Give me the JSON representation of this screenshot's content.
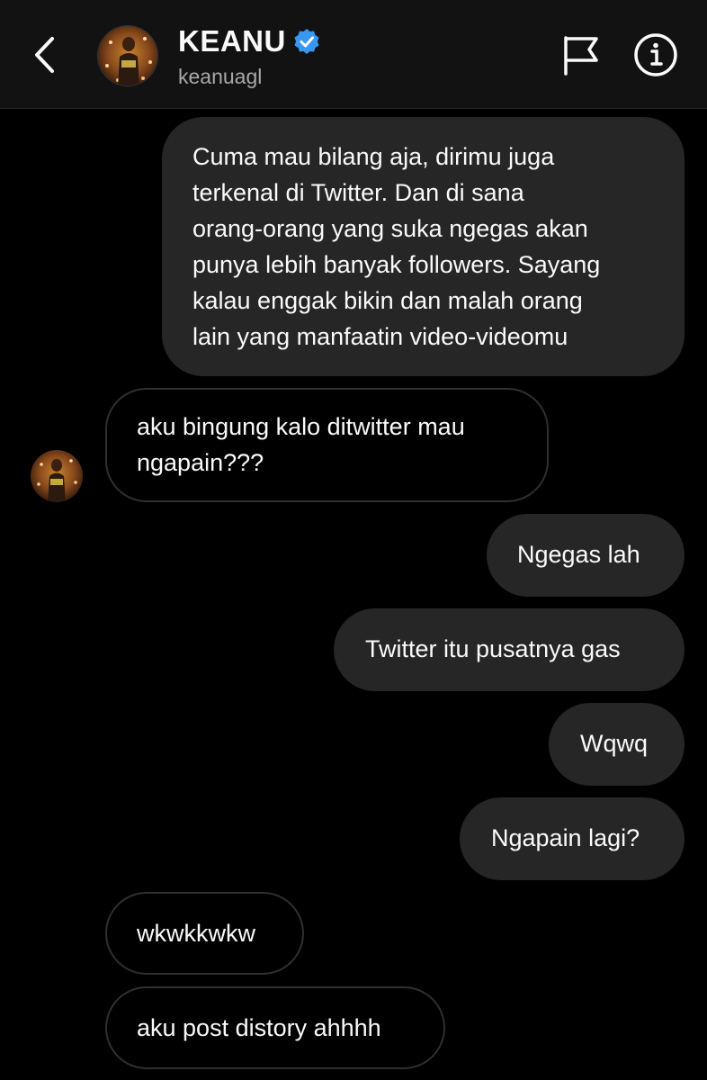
{
  "header": {
    "name": "KEANU",
    "username": "keanuagl",
    "verified": true,
    "icons": {
      "back": "chevron-left-icon",
      "report": "flag-icon",
      "info": "info-circle-icon"
    },
    "accent_color": "#3897f0"
  },
  "messages": [
    {
      "from": "me",
      "text": "Cuma mau bilang aja, dirimu juga\nterkenal di Twitter. Dan di sana\norang-orang yang suka ngegas akan\npunya lebih banyak followers. Sayang\nkalau enggak bikin dan malah orang\nlain yang manfaatin video-videomu"
    },
    {
      "from": "them",
      "text": "aku bingung kalo ditwitter mau\nngapain???"
    },
    {
      "from": "me",
      "text": "Ngegas lah"
    },
    {
      "from": "me",
      "text": "Twitter itu pusatnya gas"
    },
    {
      "from": "me",
      "text": "Wqwq"
    },
    {
      "from": "me",
      "text": "Ngapain lagi?"
    },
    {
      "from": "them",
      "text": "wkwkkwkw"
    },
    {
      "from": "them",
      "text": "aku post distory ahhhh"
    }
  ]
}
